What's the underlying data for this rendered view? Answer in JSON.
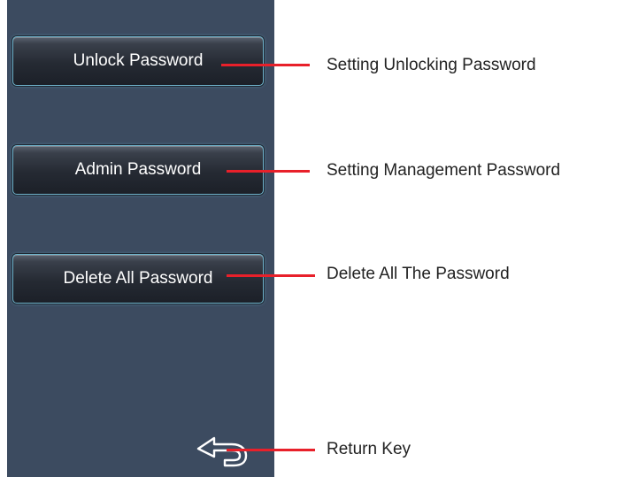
{
  "panel": {
    "buttons": [
      {
        "label": "Unlock Password"
      },
      {
        "label": "Admin Password"
      },
      {
        "label": "Delete All Password"
      }
    ],
    "return_icon": "return-arrow-icon"
  },
  "callouts": [
    {
      "text": "Setting Unlocking Password"
    },
    {
      "text": "Setting Management Password"
    },
    {
      "text": "Delete All The Password"
    },
    {
      "text": "Return Key"
    }
  ],
  "colors": {
    "panel_bg": "#3c4b60",
    "button_border": "#6fb3cc",
    "callout_line": "#e8202a"
  }
}
